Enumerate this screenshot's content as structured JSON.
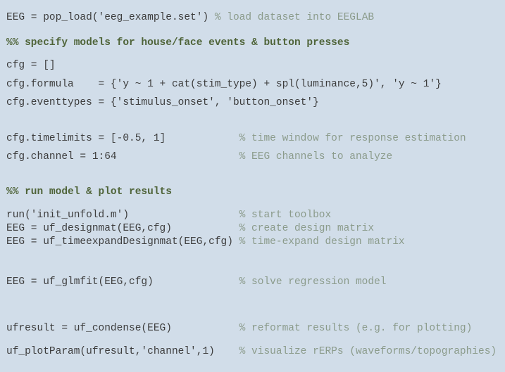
{
  "editor": {
    "language": "MATLAB",
    "colors": {
      "background": "#d1dde9",
      "code": "#3d3d3d",
      "comment": "#8b9b8b",
      "section_header": "#4f6439"
    },
    "lines": [
      {
        "type": "code",
        "code": "EEG = pop_load('eeg_example.set') ",
        "comment": "% load dataset into EEGLAB"
      },
      {
        "type": "section",
        "code": "%% specify models for house/face events & button presses",
        "comment": ""
      },
      {
        "type": "code",
        "code": "cfg = []",
        "comment": ""
      },
      {
        "type": "code",
        "code": "cfg.formula    = {'y ~ 1 + cat(stim_type) + spl(luminance,5)', 'y ~ 1'}",
        "comment": ""
      },
      {
        "type": "code",
        "code": "cfg.eventtypes = {'stimulus_onset', 'button_onset'}",
        "comment": ""
      },
      {
        "type": "code",
        "code": "cfg.timelimits = [-0.5, 1]            ",
        "comment": "% time window for response estimation"
      },
      {
        "type": "code",
        "code": "cfg.channel = 1:64                    ",
        "comment": "% EEG channels to analyze"
      },
      {
        "type": "section",
        "code": "%% run model & plot results",
        "comment": ""
      },
      {
        "type": "code",
        "code": "run('init_unfold.m')                  ",
        "comment": "% start toolbox"
      },
      {
        "type": "code",
        "code": "EEG = uf_designmat(EEG,cfg)           ",
        "comment": "% create design matrix"
      },
      {
        "type": "code",
        "code": "EEG = uf_timeexpandDesignmat(EEG,cfg) ",
        "comment": "% time-expand design matrix"
      },
      {
        "type": "code",
        "code": "EEG = uf_glmfit(EEG,cfg)              ",
        "comment": "% solve regression model"
      },
      {
        "type": "code",
        "code": "ufresult = uf_condense(EEG)           ",
        "comment": "% reformat results (e.g. for plotting)"
      },
      {
        "type": "code",
        "code": "uf_plotParam(ufresult,'channel',1)    ",
        "comment": "% visualize rERPs (waveforms/topographies)"
      }
    ]
  }
}
